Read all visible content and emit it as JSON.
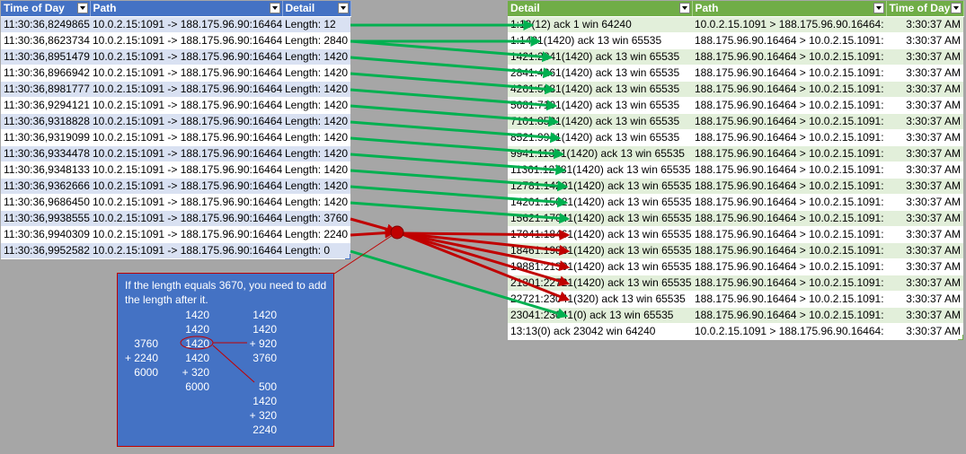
{
  "left_table": {
    "headers": [
      "Time of Day",
      "Path",
      "Detail"
    ],
    "rows": [
      [
        "11:30:36,8249865",
        "10.0.2.15:1091 -> 188.175.96.90:16464",
        "Length: 12"
      ],
      [
        "11:30:36,8623734",
        "10.0.2.15:1091 -> 188.175.96.90:16464",
        "Length: 2840"
      ],
      [
        "11:30:36,8951479",
        "10.0.2.15:1091 -> 188.175.96.90:16464",
        "Length: 1420"
      ],
      [
        "11:30:36,8966942",
        "10.0.2.15:1091 -> 188.175.96.90:16464",
        "Length: 1420"
      ],
      [
        "11:30:36,8981777",
        "10.0.2.15:1091 -> 188.175.96.90:16464",
        "Length: 1420"
      ],
      [
        "11:30:36,9294121",
        "10.0.2.15:1091 -> 188.175.96.90:16464",
        "Length: 1420"
      ],
      [
        "11:30:36,9318828",
        "10.0.2.15:1091 -> 188.175.96.90:16464",
        "Length: 1420"
      ],
      [
        "11:30:36,9319099",
        "10.0.2.15:1091 -> 188.175.96.90:16464",
        "Length: 1420"
      ],
      [
        "11:30:36,9334478",
        "10.0.2.15:1091 -> 188.175.96.90:16464",
        "Length: 1420"
      ],
      [
        "11:30:36,9348133",
        "10.0.2.15:1091 -> 188.175.96.90:16464",
        "Length: 1420"
      ],
      [
        "11:30:36,9362666",
        "10.0.2.15:1091 -> 188.175.96.90:16464",
        "Length: 1420"
      ],
      [
        "11:30:36,9686450",
        "10.0.2.15:1091 -> 188.175.96.90:16464",
        "Length: 1420"
      ],
      [
        "11:30:36,9938555",
        "10.0.2.15:1091 -> 188.175.96.90:16464",
        "Length: 3760"
      ],
      [
        "11:30:36,9940309",
        "10.0.2.15:1091 -> 188.175.96.90:16464",
        "Length: 2240"
      ],
      [
        "11:30:36,9952582",
        "10.0.2.15:1091 -> 188.175.96.90:16464",
        "Length: 0"
      ]
    ]
  },
  "right_table": {
    "headers": [
      "Detail",
      "Path",
      "Time of Day"
    ],
    "rows": [
      [
        "1:13(12) ack 1 win 64240",
        "10.0.2.15.1091 > 188.175.96.90.16464:",
        "3:30:37 AM"
      ],
      [
        "1:1421(1420) ack 13 win 65535",
        "188.175.96.90.16464 > 10.0.2.15.1091:",
        "3:30:37 AM"
      ],
      [
        "1421:2841(1420) ack 13 win 65535",
        "188.175.96.90.16464 > 10.0.2.15.1091:",
        "3:30:37 AM"
      ],
      [
        "2841:4261(1420) ack 13 win 65535",
        "188.175.96.90.16464 > 10.0.2.15.1091:",
        "3:30:37 AM"
      ],
      [
        "4261:5681(1420) ack 13 win 65535",
        "188.175.96.90.16464 > 10.0.2.15.1091:",
        "3:30:37 AM"
      ],
      [
        "5681:7101(1420) ack 13 win 65535",
        "188.175.96.90.16464 > 10.0.2.15.1091:",
        "3:30:37 AM"
      ],
      [
        "7101:8521(1420) ack 13 win 65535",
        "188.175.96.90.16464 > 10.0.2.15.1091:",
        "3:30:37 AM"
      ],
      [
        "8521:9941(1420) ack 13 win 65535",
        "188.175.96.90.16464 > 10.0.2.15.1091:",
        "3:30:37 AM"
      ],
      [
        "9941:11361(1420) ack 13 win 65535",
        "188.175.96.90.16464 > 10.0.2.15.1091:",
        "3:30:37 AM"
      ],
      [
        "11361:12781(1420) ack 13 win 65535",
        "188.175.96.90.16464 > 10.0.2.15.1091:",
        "3:30:37 AM"
      ],
      [
        "12781:14201(1420) ack 13 win 65535",
        "188.175.96.90.16464 > 10.0.2.15.1091:",
        "3:30:37 AM"
      ],
      [
        "14201:15621(1420) ack 13 win 65535",
        "188.175.96.90.16464 > 10.0.2.15.1091:",
        "3:30:37 AM"
      ],
      [
        "15621:17041(1420) ack 13 win 65535",
        "188.175.96.90.16464 > 10.0.2.15.1091:",
        "3:30:37 AM"
      ],
      [
        "17041:18461(1420) ack 13 win 65535",
        "188.175.96.90.16464 > 10.0.2.15.1091:",
        "3:30:37 AM"
      ],
      [
        "18461:19881(1420) ack 13 win 65535",
        "188.175.96.90.16464 > 10.0.2.15.1091:",
        "3:30:37 AM"
      ],
      [
        "19881:21301(1420) ack 13 win 65535",
        "188.175.96.90.16464 > 10.0.2.15.1091:",
        "3:30:37 AM"
      ],
      [
        "21301:22721(1420) ack 13 win 65535",
        "188.175.96.90.16464 > 10.0.2.15.1091:",
        "3:30:37 AM"
      ],
      [
        "22721:23041(320) ack 13 win 65535",
        "188.175.96.90.16464 > 10.0.2.15.1091:",
        "3:30:37 AM"
      ],
      [
        "23041:23041(0) ack 13 win 65535",
        "188.175.96.90.16464 > 10.0.2.15.1091:",
        "3:30:37 AM"
      ],
      [
        "13:13(0) ack 23042 win 64240",
        "10.0.2.15.1091 > 188.175.96.90.16464:",
        "3:30:37 AM"
      ]
    ]
  },
  "note": {
    "text": "If the length equals 3670, you need to add the length after it.",
    "col1": [
      "",
      "3760",
      "+ 2240",
      "6000"
    ],
    "col2": [
      "1420",
      "1420",
      "1420",
      "1420",
      "+   320",
      "6000"
    ],
    "col3": [
      "1420",
      "1420",
      "+  920",
      "3760",
      "",
      "500",
      "1420",
      "+  320",
      "2240"
    ]
  },
  "colors": {
    "left_header": "#4472c4",
    "left_band": "#d9e1f2",
    "right_header": "#70ad47",
    "right_band": "#e2efda",
    "green_arrow": "#00b050",
    "red_arrow": "#c00000"
  }
}
